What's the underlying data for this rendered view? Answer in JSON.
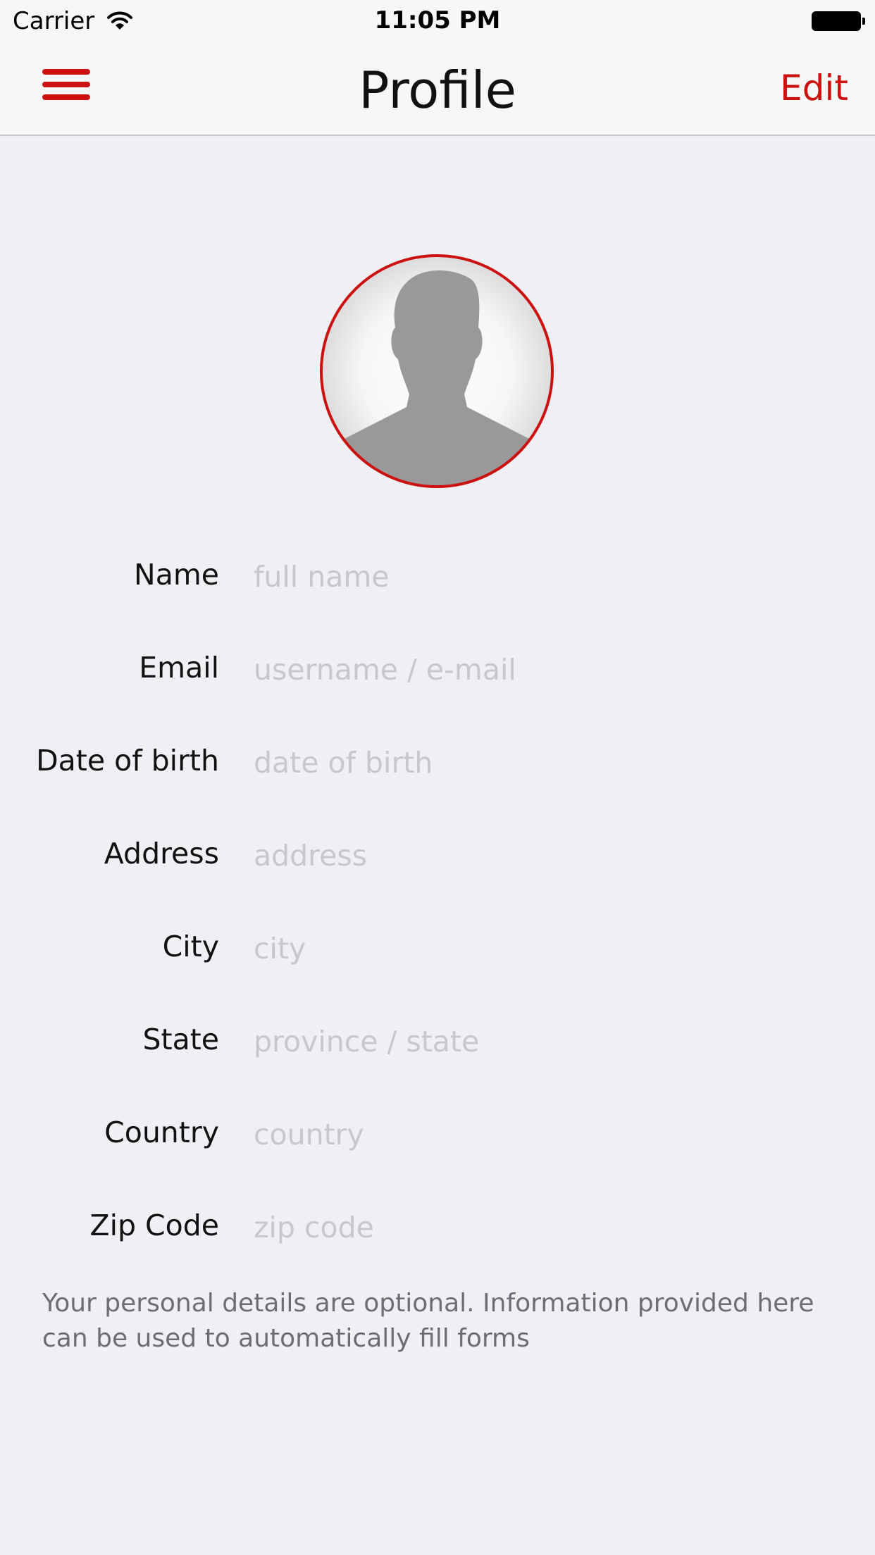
{
  "status_bar": {
    "carrier": "Carrier",
    "time": "11:05 PM"
  },
  "nav": {
    "title": "Profile",
    "edit_label": "Edit",
    "accent_color": "#cc1111"
  },
  "fields": [
    {
      "label": "Name",
      "placeholder": "full name"
    },
    {
      "label": "Email",
      "placeholder": "username / e-mail"
    },
    {
      "label": "Date of birth",
      "placeholder": "date of birth"
    },
    {
      "label": "Address",
      "placeholder": "address"
    },
    {
      "label": "City",
      "placeholder": "city"
    },
    {
      "label": "State",
      "placeholder": "province / state"
    },
    {
      "label": "Country",
      "placeholder": "country"
    },
    {
      "label": "Zip Code",
      "placeholder": "zip code"
    }
  ],
  "footer_note": "Your personal details are optional. Information provided here can be used to automatically fill forms"
}
